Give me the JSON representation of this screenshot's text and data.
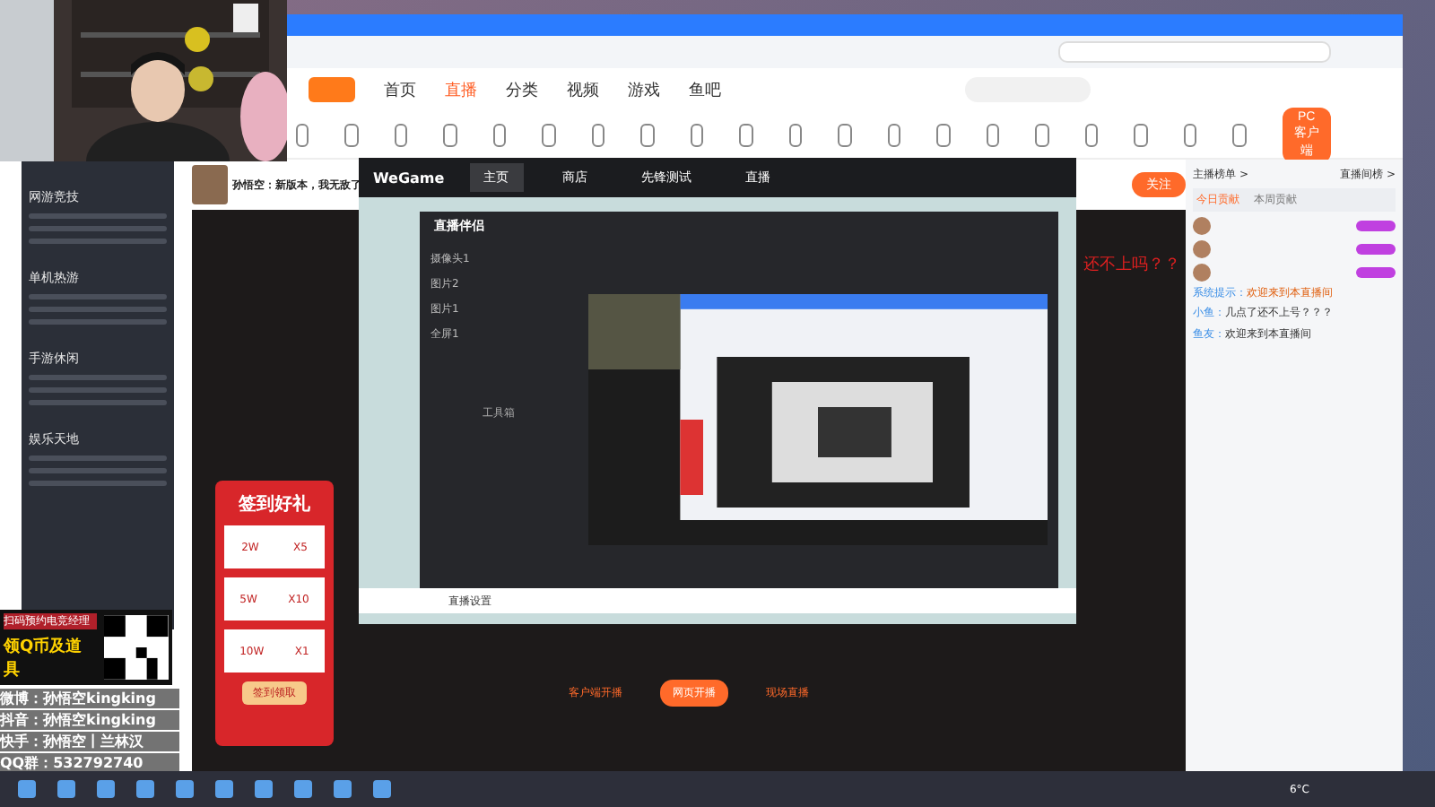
{
  "nav": [
    {
      "label": "首页",
      "selected": false
    },
    {
      "label": "直播",
      "selected": true
    },
    {
      "label": "分类",
      "selected": false
    },
    {
      "label": "视频",
      "selected": false
    },
    {
      "label": "游戏",
      "selected": false
    },
    {
      "label": "鱼吧",
      "selected": false
    }
  ],
  "client_button": "PC客户端",
  "sidebar_sections": [
    "网游竞技",
    "单机热游",
    "手游休闲",
    "娱乐天地"
  ],
  "stream": {
    "title": "孙悟空：新版本，我无敌了",
    "follow": "关注",
    "caption": "还不上吗？？",
    "buttons": [
      {
        "label": "客户端开播",
        "selected": false
      },
      {
        "label": "网页开播",
        "selected": true
      },
      {
        "label": "现场直播",
        "selected": false
      }
    ]
  },
  "chat": {
    "tabs": [
      "主播榜单 >",
      "直播间榜 >"
    ],
    "rank_tabs": [
      {
        "label": "今日贡献",
        "selected": true
      },
      {
        "label": "本周贡献",
        "selected": false
      }
    ],
    "messages": [
      {
        "kind": "system",
        "user": "系统提示：",
        "text": "欢迎来到本直播间"
      },
      {
        "kind": "user",
        "user": "小鱼：",
        "text": "几点了还不上号？？？"
      },
      {
        "kind": "user",
        "user": "鱼友：",
        "text": "欢迎来到本直播间"
      }
    ]
  },
  "wegame": {
    "logo": "WeGame",
    "tabs": [
      {
        "label": "主页",
        "selected": true
      },
      {
        "label": "商店",
        "selected": false
      },
      {
        "label": "先锋测试",
        "selected": false
      },
      {
        "label": "直播",
        "selected": false
      }
    ],
    "app_title": "直播伴侣",
    "scenes": [
      "摄像头1",
      "图片2",
      "图片1",
      "全屏1"
    ],
    "toolbox": "工具箱",
    "settings": "直播设置"
  },
  "signin": {
    "title": "签到好礼",
    "rewards": [
      {
        "amount": "2W",
        "count": "X5"
      },
      {
        "amount": "5W",
        "count": "X10"
      },
      {
        "amount": "10W",
        "count": "X1"
      }
    ],
    "button": "签到领取"
  },
  "promo": {
    "line1": "扫码预约电竞经理",
    "line2": "领Q币及道具"
  },
  "socials": [
    {
      "label": "微博：",
      "value": "孙悟空kingking"
    },
    {
      "label": "抖音：",
      "value": "孙悟空kingking"
    },
    {
      "label": "快手：",
      "value": "孙悟空丨兰林汉"
    },
    {
      "label": "QQ群：",
      "value": "532792740"
    }
  ],
  "taskbar": {
    "weather": "6°C"
  }
}
